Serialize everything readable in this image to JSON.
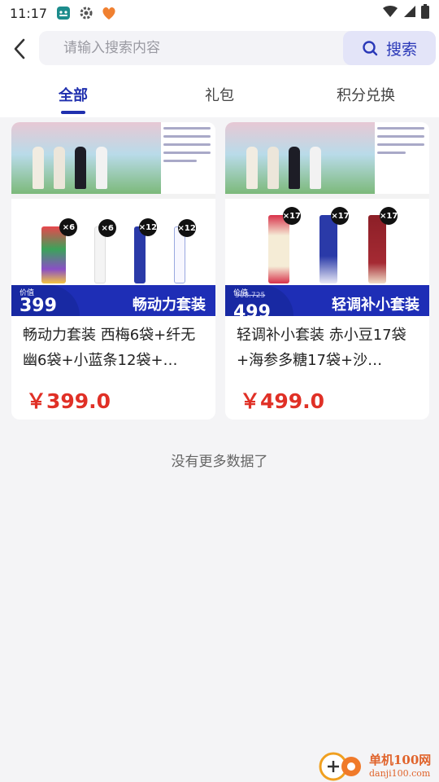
{
  "status_bar": {
    "time": "11:17",
    "icons": [
      "android-robot-icon",
      "gear-icon",
      "app-heart-icon"
    ],
    "right_icons": [
      "wifi-icon",
      "signal-icon",
      "battery-icon"
    ]
  },
  "header": {
    "back_icon": "chevron-left-icon",
    "search_placeholder": "请输入搜索内容",
    "search_value": "",
    "search_button": "搜索"
  },
  "tabs": [
    {
      "label": "全部",
      "active": true
    },
    {
      "label": "礼包",
      "active": false
    },
    {
      "label": "积分兑换",
      "active": false
    }
  ],
  "products": [
    {
      "title": "畅动力套装 西梅6袋+纤无幽6袋+小蓝条12袋+…",
      "price": "￥399.0",
      "banner_price_label": "价值",
      "banner_price": "399",
      "banner_set_name": "畅动力套装",
      "badges": [
        "×6",
        "×6",
        "×12",
        "×12"
      ]
    },
    {
      "title": "轻调补小套装 赤小豆17袋+海参多糖17袋+沙…",
      "price": "￥499.0",
      "banner_price_label": "价值",
      "banner_price": "499",
      "banner_strike": "508.725",
      "banner_set_name": "轻调补小套装",
      "badges": [
        "×17",
        "×17",
        "×17"
      ]
    }
  ],
  "footer_text": "没有更多数据了",
  "watermark": {
    "cn": "单机100网",
    "en": "danji100.com"
  },
  "colors": {
    "accent": "#1f2fae",
    "price": "#e03026",
    "search_button_bg": "#e3e4f8",
    "banner_blue": "#1e2eb6"
  }
}
